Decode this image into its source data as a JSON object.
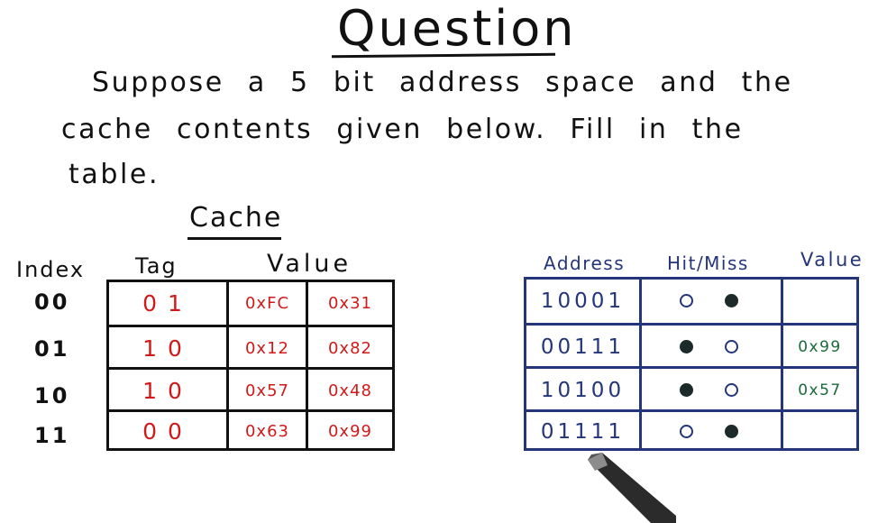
{
  "title": "Question",
  "question_lines": [
    "Suppose a 5 bit address space and the",
    "cache contents given below. Fill in the",
    "table."
  ],
  "cache": {
    "title": "Cache",
    "headers": {
      "index": "Index",
      "tag": "Tag",
      "value": "Value"
    },
    "rows": [
      {
        "index": "00",
        "tag": "01",
        "value1": "0xFC",
        "value2": "0x31"
      },
      {
        "index": "01",
        "tag": "10",
        "value1": "0x12",
        "value2": "0x82"
      },
      {
        "index": "10",
        "tag": "10",
        "value1": "0x57",
        "value2": "0x48"
      },
      {
        "index": "11",
        "tag": "00",
        "value1": "0x63",
        "value2": "0x99"
      }
    ]
  },
  "question_table": {
    "headers": {
      "address": "Address",
      "hit_miss": "Hit/Miss",
      "value": "Value"
    },
    "rows": [
      {
        "address": "10001",
        "selected": "miss",
        "value": ""
      },
      {
        "address": "00111",
        "selected": "hit",
        "value": "0x99"
      },
      {
        "address": "10100",
        "selected": "hit",
        "value": "0x57"
      },
      {
        "address": "01111",
        "selected": "miss",
        "value": ""
      }
    ]
  },
  "colors": {
    "ink": "#111111",
    "cache_values": "#d01a1a",
    "question_table": "#24357a",
    "answer_values": "#1a6a3a"
  }
}
